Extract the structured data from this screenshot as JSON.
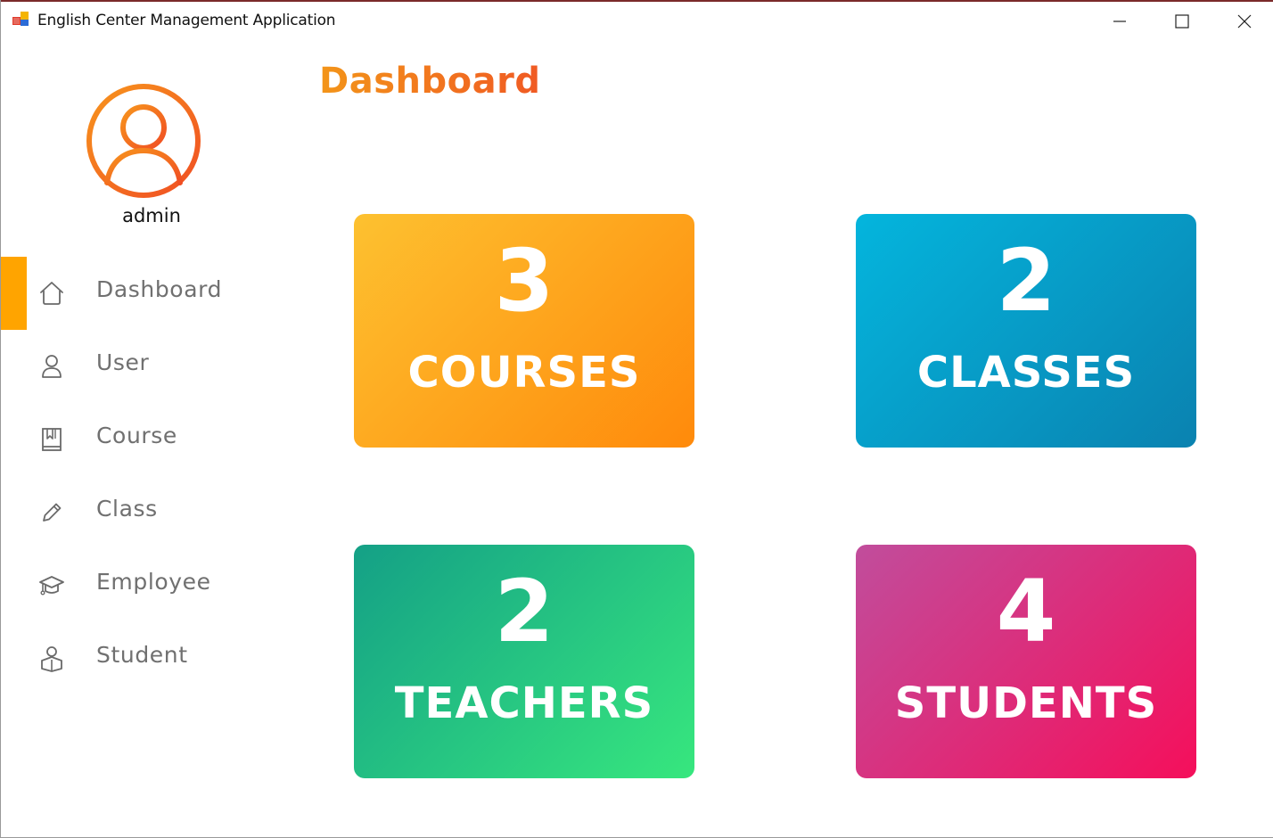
{
  "window": {
    "title": "English Center Management Application"
  },
  "sidebar": {
    "username": "admin",
    "active_index": 0,
    "items": [
      {
        "label": "Dashboard",
        "icon": "home-icon"
      },
      {
        "label": "User",
        "icon": "user-icon"
      },
      {
        "label": "Course",
        "icon": "book-icon"
      },
      {
        "label": "Class",
        "icon": "pencil-icon"
      },
      {
        "label": "Employee",
        "icon": "graduation-cap-icon"
      },
      {
        "label": "Student",
        "icon": "student-icon"
      }
    ]
  },
  "main": {
    "title": "Dashboard",
    "cards": [
      {
        "value": "3",
        "label": "COURSES"
      },
      {
        "value": "2",
        "label": "CLASSES"
      },
      {
        "value": "2",
        "label": "TEACHERS"
      },
      {
        "value": "4",
        "label": "STUDENTS"
      }
    ]
  },
  "colors": {
    "accent": "#ffa400",
    "title_gradient_start": "#f39519",
    "title_gradient_end": "#f05a23",
    "courses_gradient": [
      "#fdc130",
      "#ff8a0b"
    ],
    "classes_gradient": [
      "#04b5dd",
      "#0a82b0"
    ],
    "teachers_gradient": [
      "#14a086",
      "#37e77e"
    ],
    "students_gradient": [
      "#c14d9c",
      "#f50f5b"
    ],
    "nav_text": "#707070"
  }
}
